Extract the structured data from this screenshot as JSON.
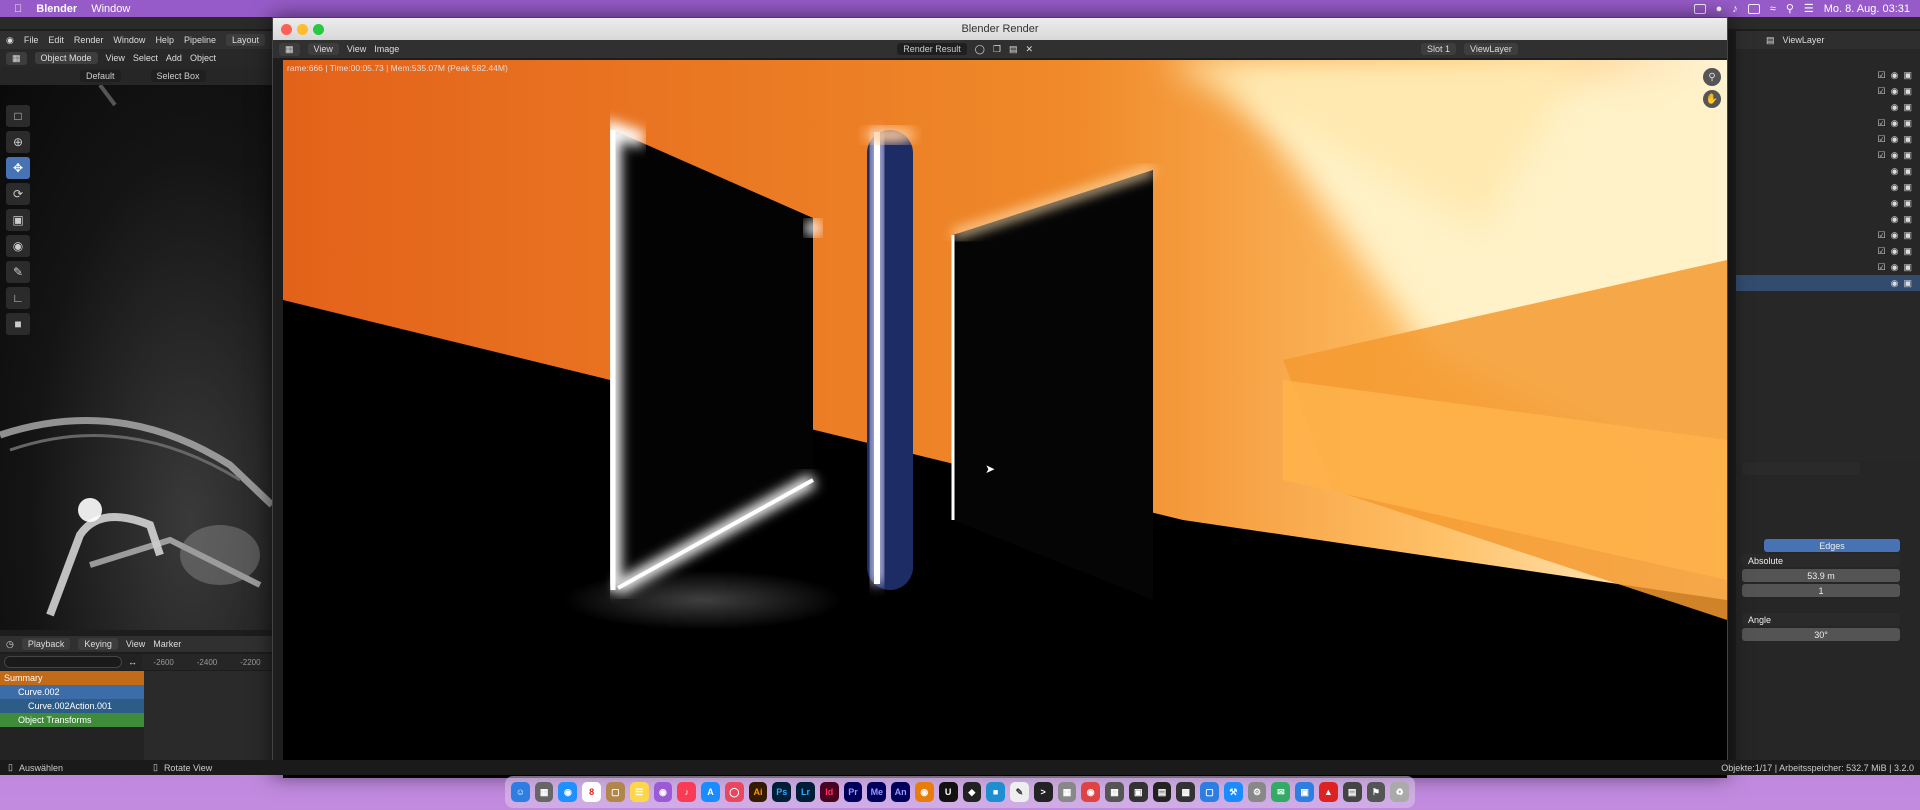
{
  "menubar": {
    "app": "Blender",
    "menu": "Window",
    "clock": "Mo. 8. Aug. 03:31"
  },
  "left3d": {
    "menu": [
      "File",
      "Edit",
      "Render",
      "Window",
      "Help",
      "Pipeline"
    ],
    "workspace_tab": "Layout",
    "mode": "Object Mode",
    "view_menus": [
      "View",
      "Select",
      "Add",
      "Object"
    ],
    "orientation": "Default",
    "select_mode": "Select Box",
    "tools": [
      "cursor-icon",
      "move-icon",
      "rotate-icon",
      "scale-icon",
      "transform-icon",
      "annotate-icon",
      "measure-icon",
      "add-cube-icon"
    ]
  },
  "dopesheet": {
    "menus": [
      "Playback",
      "Keying",
      "View",
      "Marker"
    ],
    "ruler": [
      "-2600",
      "-2400",
      "-2200"
    ],
    "rows": [
      "Summary",
      "Curve.002",
      "Curve.002Action.001",
      "Object Transforms"
    ]
  },
  "render_window": {
    "title": "Blender Render",
    "menus": [
      "View",
      "View",
      "Image"
    ],
    "image_name": "Render Result",
    "slot": "Slot 1",
    "view_layer": "ViewLayer",
    "info": "rame:666 | Time:00:05.73 | Mem:535.07M (Peak 582.44M)"
  },
  "outliner": {
    "view_layer": "ViewLayer"
  },
  "properties": {
    "tab_label": "Edges",
    "mode": "Absolute",
    "distance": "53.9 m",
    "count": "1",
    "angle_mode": "Angle",
    "angle": "30°"
  },
  "status": {
    "left": "Auswählen",
    "middle": "Rotate View",
    "right": "Objekte:1/17 | Arbeitsspeicher: 532.7 MiB | 3.2.0"
  }
}
